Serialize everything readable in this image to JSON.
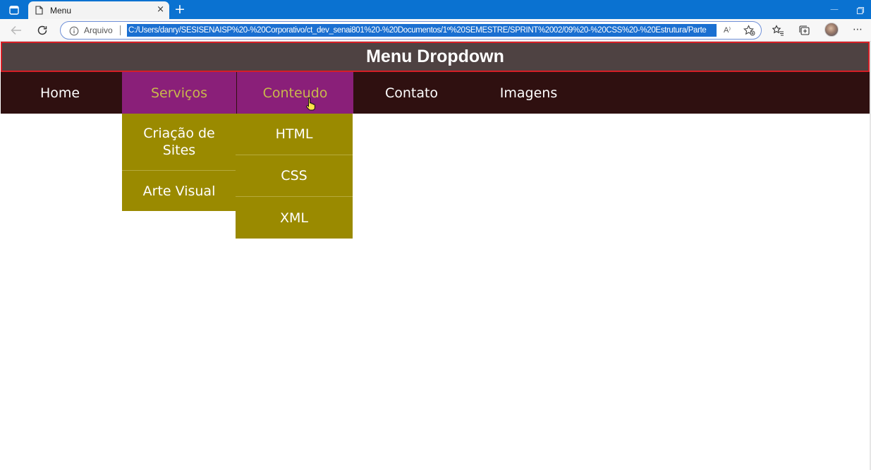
{
  "browser": {
    "tab": {
      "title": "Menu",
      "close_glyph": "×",
      "newtab_glyph": "+"
    },
    "address": {
      "label": "Arquivo",
      "url": "C:/Users/danry/SESISENAISP%20-%20Corporativo/ct_dev_senai801%20-%20Documentos/1º%20SEMESTRE/SPRINT%2002/09%20-%20CSS%20-%20Estrutura/Parte",
      "read_aloud": "A⁾",
      "more_glyph": "⋯"
    },
    "icons": [
      "window-icon",
      "document-icon",
      "back-icon",
      "refresh-icon",
      "info-icon",
      "favorite-add-icon",
      "favorites-icon",
      "collections-icon",
      "profile-avatar",
      "more-icon"
    ]
  },
  "page": {
    "header": {
      "title": "Menu Dropdown"
    },
    "nav": {
      "items": [
        {
          "label": "Home",
          "active": false
        },
        {
          "label": "Serviços",
          "active": true
        },
        {
          "label": "Conteudo",
          "active": true
        },
        {
          "label": "Contato",
          "active": false
        },
        {
          "label": "Imagens",
          "active": false
        }
      ],
      "servicos_dropdown": [
        "Criação de Sites",
        "Arte Visual"
      ],
      "conteudo_dropdown": [
        "HTML",
        "CSS",
        "XML"
      ]
    },
    "colors": {
      "header_bg": "#4e4242",
      "header_border": "#d51f26",
      "navbar_bg": "#2f1010",
      "active_bg": "#8a1f79",
      "active_text": "#c9b84c",
      "dropdown_bg": "#9a8a00"
    }
  }
}
